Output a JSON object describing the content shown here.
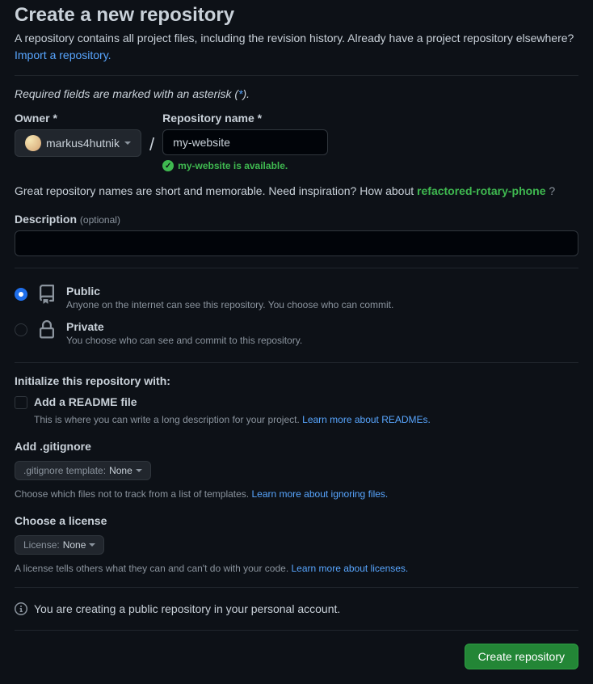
{
  "header": {
    "title": "Create a new repository",
    "subtitle": "A repository contains all project files, including the revision history. Already have a project repository elsewhere? ",
    "import_link": "Import a repository."
  },
  "required_note": {
    "prefix": "Required fields are marked with an asterisk (",
    "star": "*",
    "suffix": ")."
  },
  "owner": {
    "label": "Owner *",
    "name": "markus4hutnik"
  },
  "repo": {
    "label": "Repository name *",
    "value": "my-website",
    "avail_text": "my-website is available."
  },
  "name_tip": {
    "prefix": "Great repository names are short and memorable. Need inspiration? How about ",
    "suggestion": "refactored-rotary-phone",
    "suffix": " ?"
  },
  "description": {
    "label": "Description ",
    "optional": "(optional)"
  },
  "visibility": {
    "public": {
      "title": "Public",
      "desc": "Anyone on the internet can see this repository. You choose who can commit."
    },
    "private": {
      "title": "Private",
      "desc": "You choose who can see and commit to this repository."
    }
  },
  "init": {
    "heading": "Initialize this repository with:",
    "readme": {
      "label": "Add a README file",
      "help": "This is where you can write a long description for your project. ",
      "link": "Learn more about READMEs."
    },
    "gitignore": {
      "label": "Add .gitignore",
      "dropdown_prefix": ".gitignore template: ",
      "dropdown_value": "None",
      "help": "Choose which files not to track from a list of templates. ",
      "link": "Learn more about ignoring files."
    },
    "license": {
      "label": "Choose a license",
      "dropdown_prefix": "License: ",
      "dropdown_value": "None",
      "help": "A license tells others what they can and can't do with your code. ",
      "link": "Learn more about licenses."
    }
  },
  "info_msg": "You are creating a public repository in your personal account.",
  "submit": "Create repository"
}
